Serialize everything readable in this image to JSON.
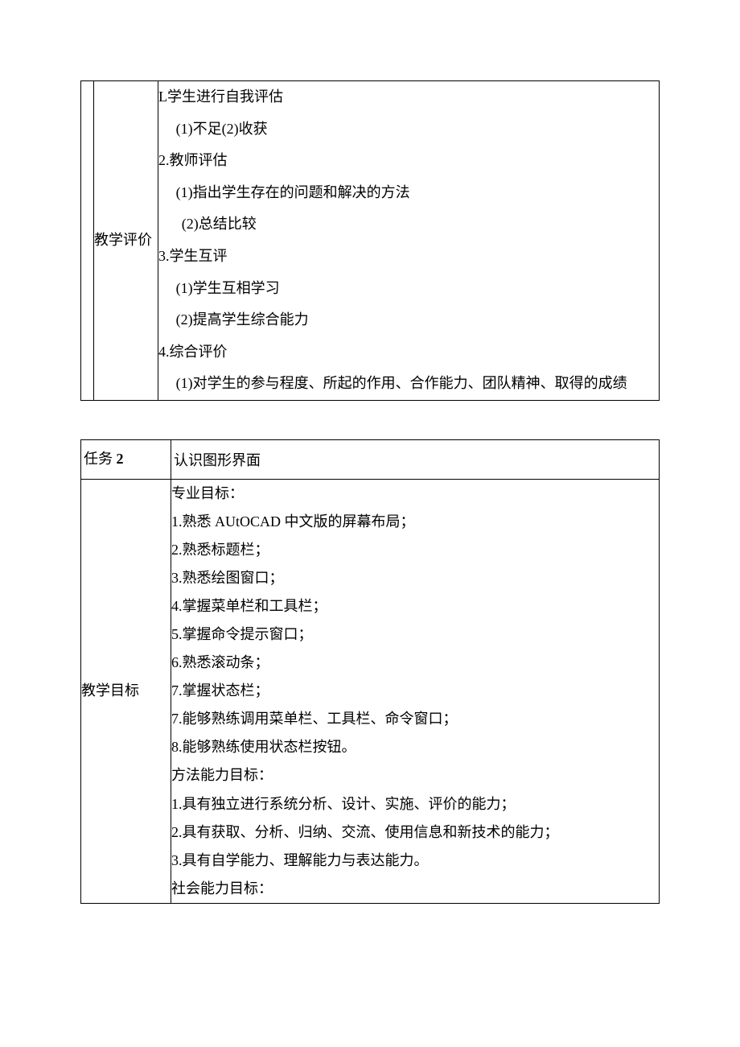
{
  "table1": {
    "rowLabel": "教学评价",
    "content": [
      {
        "cls": "",
        "t": "L学生进行自我评估"
      },
      {
        "cls": "indent1",
        "t": "(1)不足(2)收获"
      },
      {
        "cls": "",
        "t": "2.教师评估"
      },
      {
        "cls": "indent1",
        "t": "(1)指出学生存在的问题和解决的方法"
      },
      {
        "cls": "indent2",
        "t": "(2)总结比较"
      },
      {
        "cls": "",
        "t": "3.学生互评"
      },
      {
        "cls": "indent1",
        "t": "(1)学生互相学习"
      },
      {
        "cls": "indent1",
        "t": "(2)提高学生综合能力"
      },
      {
        "cls": "",
        "t": "4.综合评价"
      },
      {
        "cls": "indent1",
        "t": "(1)对学生的参与程度、所起的作用、合作能力、团队精神、取得的成绩"
      }
    ]
  },
  "table2": {
    "taskLabelPrefix": "任务",
    "taskNumber": "2",
    "taskTitle": "认识图形界面",
    "goalsLabel": "教学目标",
    "goalsContent": [
      "专业目标：",
      "1.熟悉 AUtOCAD 中文版的屏幕布局；",
      "2.熟悉标题栏；",
      "3.熟悉绘图窗口；",
      "4.掌握菜单栏和工具栏；",
      "5.掌握命令提示窗口；",
      "6.熟悉滚动条；",
      "7.掌握状态栏；",
      "7.能够熟练调用菜单栏、工具栏、命令窗口；",
      "8.能够熟练使用状态栏按钮。",
      "方法能力目标：",
      "1.具有独立进行系统分析、设计、实施、评价的能力；",
      "2.具有获取、分析、归纳、交流、使用信息和新技术的能力；",
      "3.具有自学能力、理解能力与表达能力。",
      "社会能力目标："
    ]
  }
}
